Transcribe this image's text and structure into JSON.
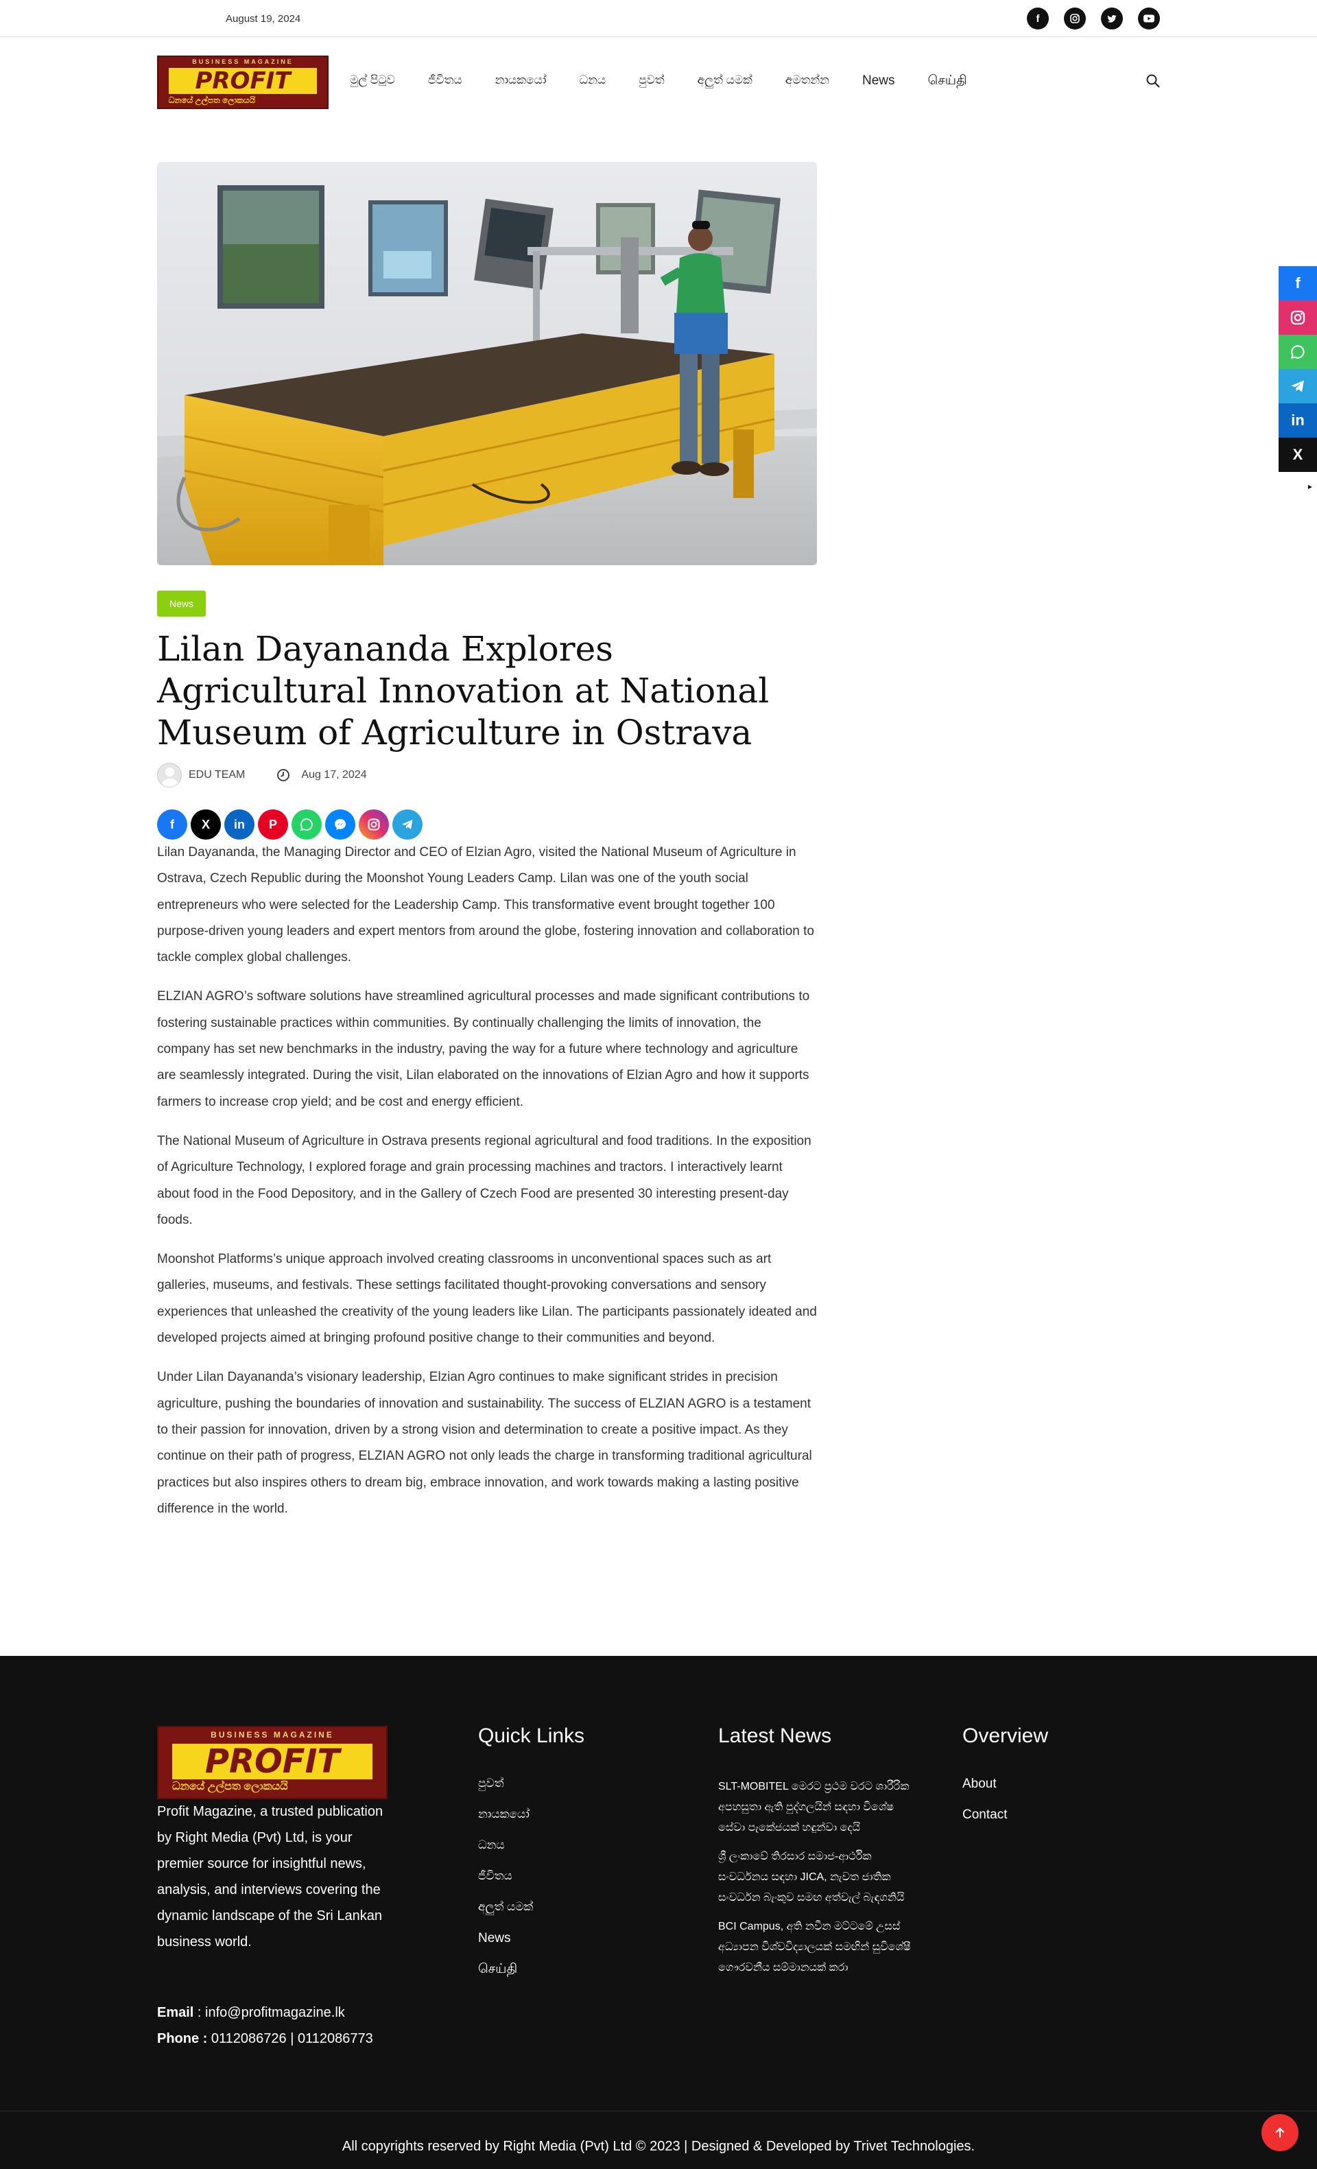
{
  "topbar": {
    "date": "August 19, 2024",
    "social_icons": [
      "facebook-icon",
      "instagram-icon",
      "twitter-icon",
      "youtube-icon"
    ]
  },
  "logo": {
    "top_text": "BUSINESS MAGAZINE",
    "main_text": "PROFIT",
    "sub_text": "ධනයේ උල්පත ලොකයයි"
  },
  "nav": {
    "items": [
      "මුල් පිටුව",
      "ජීවිතය",
      "නායකයෝ",
      "ධනය",
      "පුවත්",
      "අලුත් යමක්",
      "අමතන්න",
      "News",
      "செய்தி"
    ]
  },
  "article": {
    "tag": "News",
    "title": "Lilan Dayananda Explores Agricultural Innovation at National Museum of Agriculture in Ostrava",
    "author": "EDU TEAM",
    "date": "Aug 17, 2024",
    "share_icons": [
      "facebook-icon",
      "x-icon",
      "linkedin-icon",
      "pinterest-icon",
      "whatsapp-icon",
      "messenger-icon",
      "instagram-icon",
      "telegram-icon"
    ],
    "paragraphs": [
      "Lilan Dayananda, the Managing Director and CEO of Elzian Agro, visited the National Museum of Agriculture in Ostrava, Czech Republic during the Moonshot Young Leaders Camp. Lilan was one of the youth social entrepreneurs who were selected for the Leadership Camp. This transformative event brought together 100 purpose-driven young leaders and expert mentors from around the globe, fostering innovation and collaboration to tackle complex global challenges.",
      "ELZIAN AGRO’s software solutions have streamlined agricultural processes and made significant contributions to fostering sustainable practices within communities. By continually challenging the limits of innovation, the company has set new benchmarks in the industry, paving the way for a future where technology and agriculture are seamlessly integrated. During the visit, Lilan elaborated on the innovations of Elzian Agro and how it supports farmers to increase crop yield; and be cost and energy efficient.",
      "The National Museum of Agriculture in Ostrava presents regional agricultural and food traditions. In the exposition of Agriculture Technology, I explored forage and grain processing machines and tractors. I interactively learnt about food in the Food Depository, and in the Gallery of Czech Food are presented 30 interesting present-day foods.",
      "Moonshot Platforms’s unique approach involved creating classrooms in unconventional spaces such as art galleries, museums, and festivals. These settings facilitated thought-provoking conversations and sensory experiences that unleashed the creativity of the young leaders like Lilan. The participants passionately ideated and developed projects aimed at bringing profound positive change to their communities and beyond.",
      "Under Lilan Dayananda’s visionary leadership, Elzian Agro continues to make significant strides in precision agriculture, pushing the boundaries of innovation and sustainability. The success of ELZIAN AGRO is a testament to their passion for innovation, driven by a strong vision and determination to create a positive impact. As they continue on their path of progress, ELZIAN AGRO not only leads the charge in transforming traditional agricultural practices but also inspires others to dream big, embrace innovation, and work towards making a lasting positive difference in the world."
    ]
  },
  "float_share": [
    "facebook-icon",
    "instagram-icon",
    "whatsapp-icon",
    "telegram-icon",
    "linkedin-icon",
    "x-icon"
  ],
  "footer": {
    "about": "Profit Magazine, a trusted publication by Right Media (Pvt) Ltd, is your premier source for insightful news, analysis, and interviews covering the dynamic landscape of the Sri Lankan business world.",
    "email_label": "Email",
    "email": " : info@profitmagazine.lk",
    "phone_label": "Phone :",
    "phone": " 0112086726 | 0112086773",
    "quick_links_title": "Quick Links",
    "quick_links": [
      "පුවත්",
      "නායකයෝ",
      "ධනය",
      "ජීවිතය",
      "අලුත් යමක්",
      "News",
      "செய்தி"
    ],
    "latest_news_title": "Latest News",
    "latest_news": [
      "SLT-MOBITEL මෙරට ප්‍රථම වරට ශාරීරික අපහසුතා ඇති පුද්ගලයින් සඳහා විශේෂ සේවා පැකේජයක් හඳුන්වා දෙයි",
      "ශ්‍රී ලංකාවේ තිරසාර සමාජ-ආර්ථික සංවර්ධනය සඳහා JICA, නැවත ජාතික සංවර්ධන බැංකුව සමඟ අත්වැල් බැඳගනියි",
      "BCI Campus, අති නවීන මට්ටමේ උසස් අධ්‍යාපන විශ්වවිද්‍යාලයක් සමඟින් සුවිශේෂී ගෞරවනීය සම්මානයක් කරා"
    ],
    "overview_title": "Overview",
    "overview": [
      "About",
      "Contact"
    ],
    "copyright": "All copyrights reserved by Right Media (Pvt) Ltd © 2023 | Designed & Developed by Trivet Technologies."
  },
  "colors": {
    "tag_green": "#8ccf0f",
    "footer_bg": "#111111",
    "logo_red": "#7a1512",
    "logo_yellow": "#f7d51d",
    "to_top_red": "#f03030"
  }
}
